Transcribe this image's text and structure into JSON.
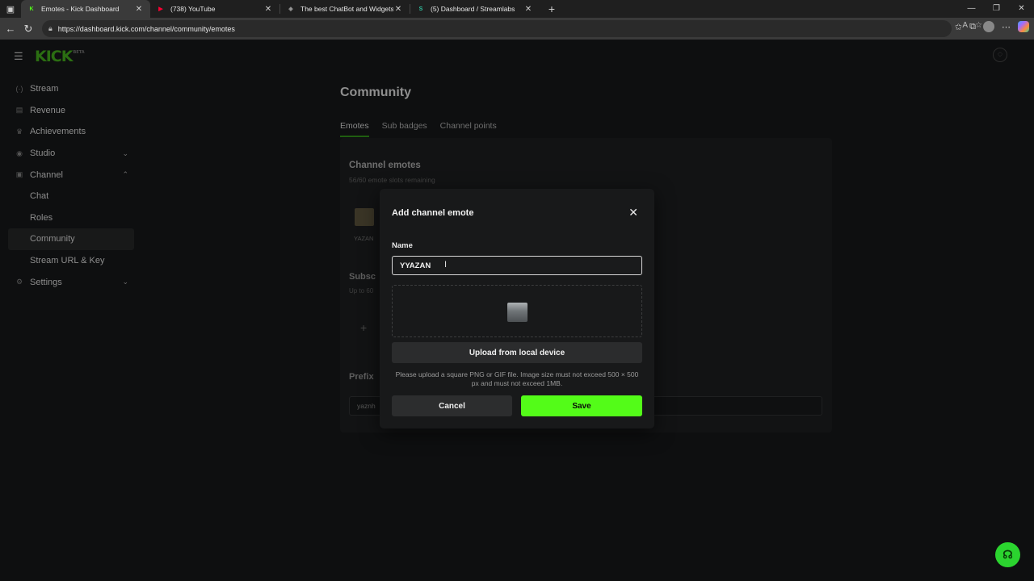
{
  "browser": {
    "tabs": [
      {
        "title": "Emotes - Kick Dashboard",
        "favicon": "K",
        "favicon_color": "#53fc18",
        "active": true
      },
      {
        "title": "(738) YouTube",
        "favicon": "▶",
        "favicon_color": "#ff0033",
        "active": false
      },
      {
        "title": "The best ChatBot and Widgets fo",
        "favicon": "◈",
        "favicon_color": "#9a9a9a",
        "active": false
      },
      {
        "title": "(5) Dashboard / Streamlabs",
        "favicon": "S",
        "favicon_color": "#31c3a2",
        "active": false
      }
    ],
    "url": "https://dashboard.kick.com/channel/community/emotes"
  },
  "app": {
    "logo": "KICK",
    "logo_badge": "BETA",
    "accent": "#53fc18"
  },
  "sidebar": {
    "items": [
      {
        "label": "Stream",
        "icon": "broadcast-icon",
        "glyph": "(·)"
      },
      {
        "label": "Revenue",
        "icon": "revenue-icon",
        "glyph": "▤"
      },
      {
        "label": "Achievements",
        "icon": "trophy-icon",
        "glyph": "♛"
      },
      {
        "label": "Studio",
        "icon": "studio-icon",
        "glyph": "◉",
        "chevron": "⌄"
      },
      {
        "label": "Channel",
        "icon": "channel-icon",
        "glyph": "▣",
        "chevron": "⌃"
      },
      {
        "label": "Chat",
        "sub": true
      },
      {
        "label": "Roles",
        "sub": true
      },
      {
        "label": "Community",
        "sub": true,
        "active": true
      },
      {
        "label": "Stream URL & Key",
        "sub": true
      },
      {
        "label": "Settings",
        "icon": "gear-icon",
        "glyph": "⚙",
        "chevron": "⌄"
      }
    ]
  },
  "main": {
    "title": "Community",
    "tabs": [
      "Emotes",
      "Sub badges",
      "Channel points"
    ],
    "channel_emotes": {
      "title": "Channel emotes",
      "slots": "56/60 emote slots remaining",
      "emote_label": "YAZAN"
    },
    "subscriber_section": {
      "title": "Subsc",
      "sub": "Up to 60"
    },
    "prefix_section": {
      "title": "Prefix",
      "value": "yaznh"
    }
  },
  "modal": {
    "title": "Add channel emote",
    "name_label": "Name",
    "name_value": "YYAZAN",
    "upload_label": "Upload from local device",
    "hint": "Please upload a square PNG or GIF file. Image size must not exceed 500 × 500 px and must not exceed 1MB.",
    "cancel_label": "Cancel",
    "save_label": "Save"
  }
}
